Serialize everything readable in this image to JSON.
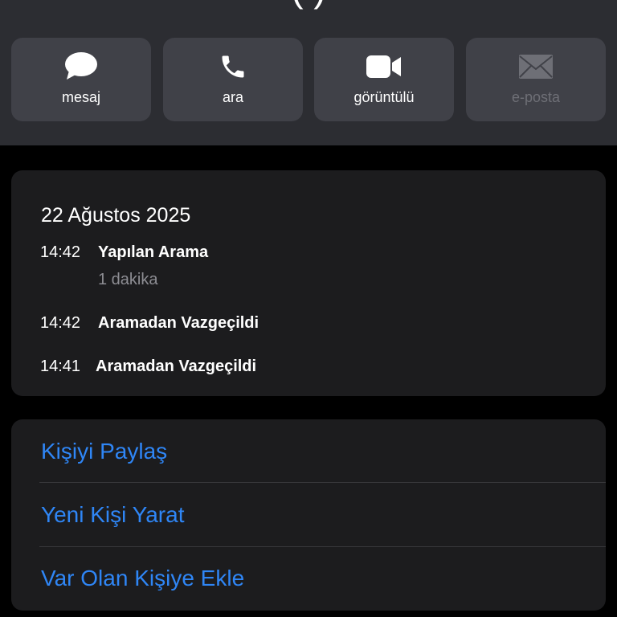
{
  "header": {
    "title_fragment": "(   )"
  },
  "actions": [
    {
      "label": "mesaj",
      "icon": "message-icon"
    },
    {
      "label": "ara",
      "icon": "phone-icon"
    },
    {
      "label": "görüntülü",
      "icon": "video-icon"
    },
    {
      "label": "e-posta",
      "icon": "mail-icon"
    }
  ],
  "history": {
    "date": "22 Ağustos 2025",
    "entries": [
      {
        "time": "14:42",
        "title": "Yapılan Arama",
        "detail": "1 dakika"
      },
      {
        "time": "14:42",
        "title": "Aramadan Vazgeçildi"
      },
      {
        "time": "14:41",
        "title": "Aramadan Vazgeçildi"
      }
    ]
  },
  "links": [
    {
      "label": "Kişiyi Paylaş"
    },
    {
      "label": "Yeni Kişi Yarat"
    },
    {
      "label": "Var Olan Kişiye Ekle"
    }
  ],
  "colors": {
    "accent": "#2f86f6",
    "header_bg": "#2c2d32",
    "button_bg": "#404148",
    "card_bg": "#1c1c1e",
    "disabled": "#6e6f76",
    "secondary_text": "#8d8d93"
  }
}
